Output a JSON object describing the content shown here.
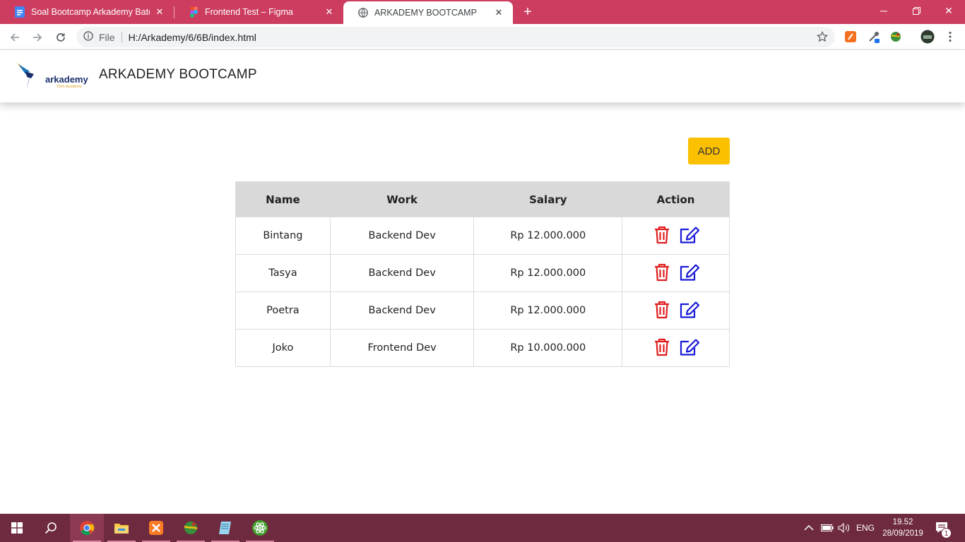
{
  "browser": {
    "tabs": [
      {
        "title": "Soal Bootcamp Arkademy Batch"
      },
      {
        "title": "Frontend Test – Figma"
      },
      {
        "title": "ARKADEMY BOOTCAMP"
      }
    ],
    "address": {
      "scheme_label": "File",
      "url": "H:/Arkademy/6/6B/index.html"
    }
  },
  "header": {
    "logo_text": "arkademy",
    "logo_subtext": "Tech Academy",
    "title": "ARKADEMY BOOTCAMP"
  },
  "toolbar": {
    "add_label": "ADD"
  },
  "table": {
    "headers": [
      "Name",
      "Work",
      "Salary",
      "Action"
    ],
    "rows": [
      {
        "name": "Bintang",
        "work": "Backend Dev",
        "salary": "Rp 12.000.000"
      },
      {
        "name": "Tasya",
        "work": "Backend Dev",
        "salary": "Rp 12.000.000"
      },
      {
        "name": "Poetra",
        "work": "Backend Dev",
        "salary": "Rp 12.000.000"
      },
      {
        "name": "Joko",
        "work": "Frontend Dev",
        "salary": "Rp 10.000.000"
      }
    ],
    "action_icons": [
      "trash-icon",
      "edit-icon"
    ]
  },
  "taskbar": {
    "apps": [
      "windows-start-icon",
      "search-icon",
      "chrome-icon",
      "file-explorer-icon",
      "xampp-icon",
      "network-globe-icon",
      "notepad-icon",
      "atom-icon"
    ],
    "language": "ENG",
    "time": "19.52",
    "date": "28/09/2019",
    "notification_count": "1"
  },
  "colors": {
    "chrome_accent": "#cc3d5f",
    "taskbar": "#6e2a3e",
    "add_button": "#fbc000",
    "table_header": "#d9d9d9",
    "delete_icon": "#e01e1e",
    "edit_icon": "#1a1ad6"
  }
}
